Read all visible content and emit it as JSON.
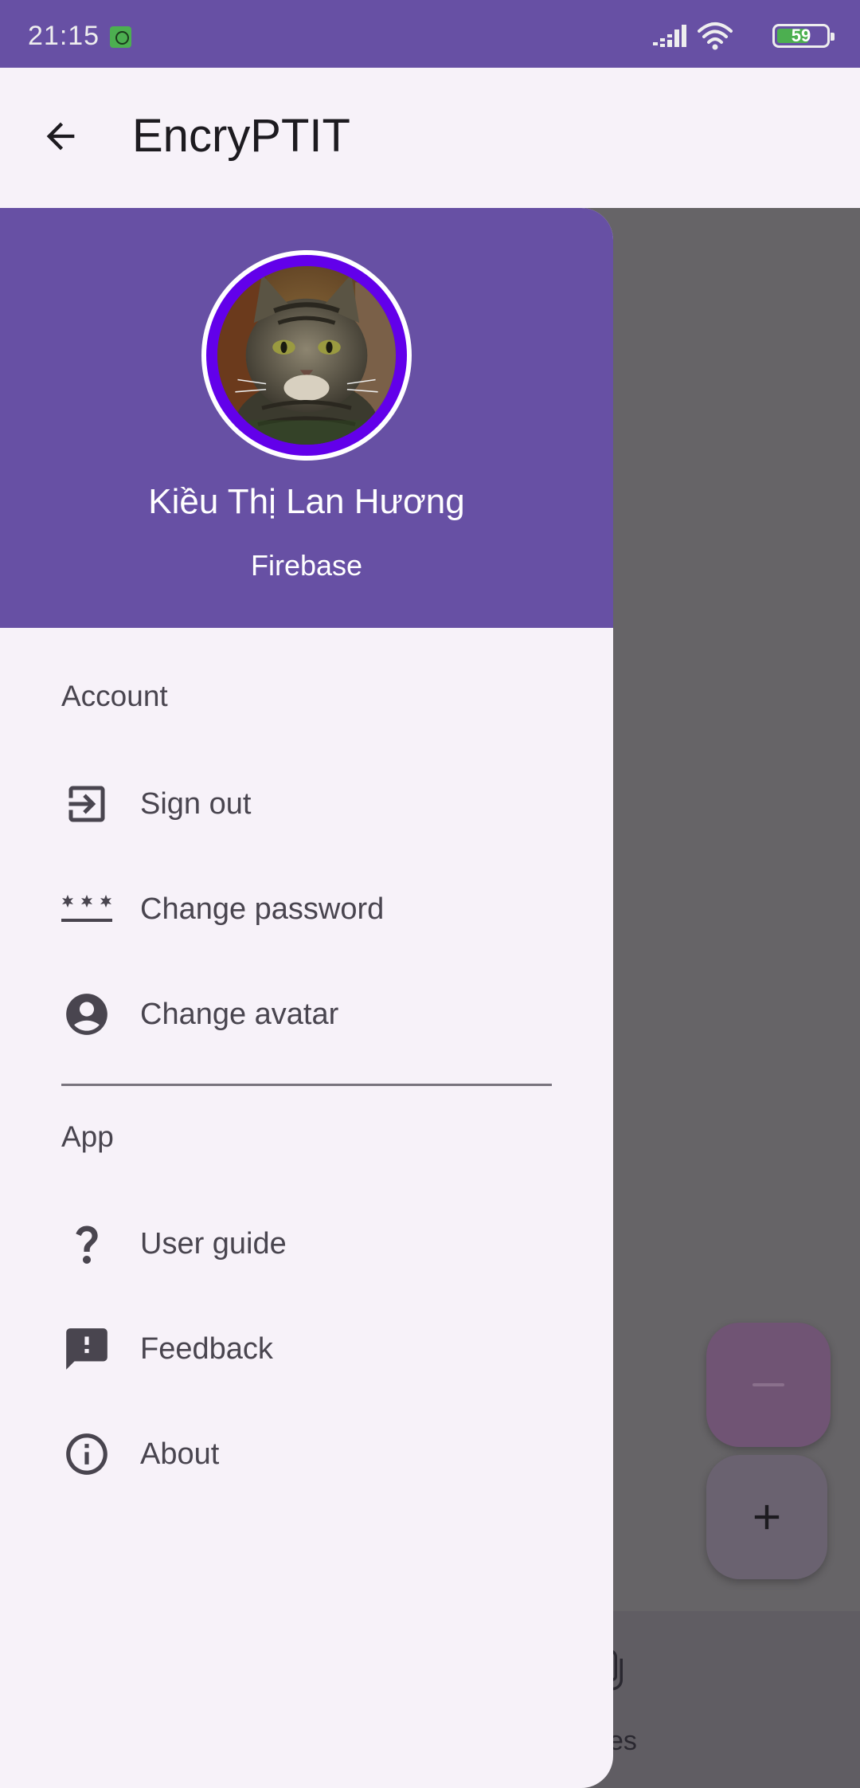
{
  "status_bar": {
    "time": "21:15",
    "battery": "59",
    "icons": [
      "notification-app-icon",
      "signal-icon",
      "wifi-icon",
      "battery-icon"
    ]
  },
  "app_bar": {
    "title": "EncryPTIT",
    "back_icon": "arrow-back-icon"
  },
  "drawer": {
    "header": {
      "user_name": "Kiều Thị Lan Hương",
      "provider": "Firebase"
    },
    "sections": {
      "account": {
        "label": "Account",
        "items": [
          {
            "label": "Sign out",
            "icon": "sign-out-icon"
          },
          {
            "label": "Change password",
            "icon": "password-icon"
          },
          {
            "label": "Change avatar",
            "icon": "account-circle-icon"
          }
        ]
      },
      "app": {
        "label": "App",
        "items": [
          {
            "label": "User guide",
            "icon": "question-mark-icon"
          },
          {
            "label": "Feedback",
            "icon": "feedback-icon"
          },
          {
            "label": "About",
            "icon": "info-icon"
          }
        ]
      }
    }
  },
  "background": {
    "bottom_nav_label_partial": "es",
    "fab_minus_icon": "minus-icon",
    "fab_plus_icon": "plus-icon"
  },
  "colors": {
    "primary": "#6750a4",
    "avatar_ring": "#6200ea",
    "surface": "#f7f2f9",
    "scrim": "#666467",
    "text": "#49454f"
  }
}
